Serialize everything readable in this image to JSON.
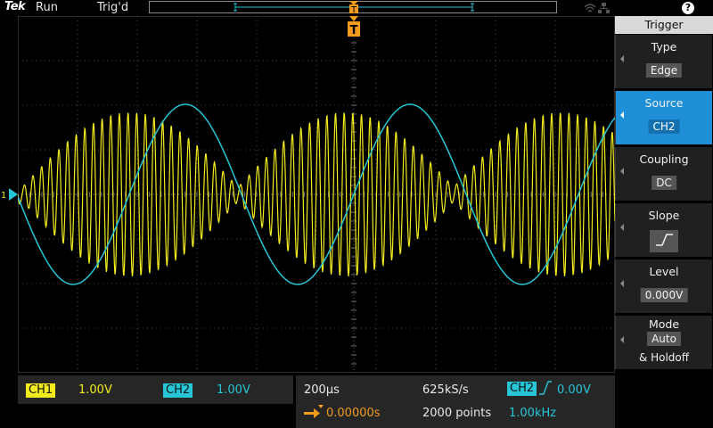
{
  "top_bar": {
    "brand": "Tek",
    "acquisition_state": "Run",
    "trigger_state": "Trig'd"
  },
  "trigger_menu": {
    "title": "Trigger",
    "help": "?",
    "items": [
      {
        "label": "Type",
        "value": "Edge"
      },
      {
        "label": "Source",
        "value": "CH2"
      },
      {
        "label": "Coupling",
        "value": "DC"
      },
      {
        "label": "Slope",
        "value": "rising-edge-icon"
      },
      {
        "label": "Level",
        "value": "0.000V"
      },
      {
        "label": "Mode",
        "value": "Auto",
        "sub": "& Holdoff"
      }
    ]
  },
  "readouts": {
    "ch1": {
      "name": "CH1",
      "scale": "1.00V"
    },
    "ch2": {
      "name": "CH2",
      "scale": "1.00V"
    },
    "horizontal": {
      "time_per_div": "200µs",
      "sample_rate": "625kS/s",
      "delay": "0.00000s",
      "record_length": "2000 points"
    },
    "trigger": {
      "source": "CH2",
      "level": "0.00V",
      "frequency": "1.00kHz"
    }
  },
  "colors": {
    "ch1": "#f2ec1e",
    "ch2": "#27c6d6",
    "trigger": "#f29b1e",
    "menu_active": "#1f8fd8"
  },
  "channel_marker": {
    "ch1_label": "1"
  },
  "trigger_marker": {
    "label": "T"
  }
}
